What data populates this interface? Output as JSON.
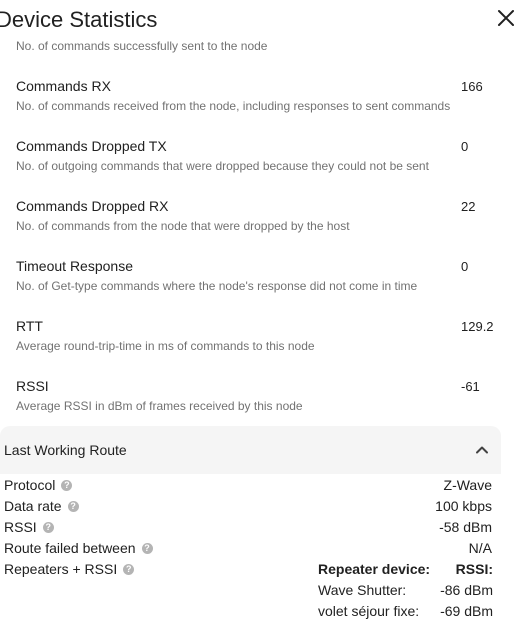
{
  "dialog": {
    "title": "Device Statistics",
    "close_icon": "close-icon"
  },
  "partial_description": "No. of commands successfully sent to the node",
  "stats": [
    {
      "label": "Commands RX",
      "description": "No. of commands received from the node, including responses to sent commands",
      "value": "166"
    },
    {
      "label": "Commands Dropped TX",
      "description": "No. of outgoing commands that were dropped because they could not be sent",
      "value": "0"
    },
    {
      "label": "Commands Dropped RX",
      "description": "No. of commands from the node that were dropped by the host",
      "value": "22"
    },
    {
      "label": "Timeout Response",
      "description": "No. of Get-type commands where the node's response did not come in time",
      "value": "0"
    },
    {
      "label": "RTT",
      "description": "Average round-trip-time in ms of commands to this node",
      "value": "129.2"
    },
    {
      "label": "RSSI",
      "description": "Average RSSI in dBm of frames received by this node",
      "value": "-61"
    }
  ],
  "last_working_route": {
    "title": "Last Working Route",
    "expanded": true,
    "chevron_icon": "chevron-up-icon",
    "help_icon": "help-circle-icon",
    "rows": [
      {
        "label": "Protocol",
        "value": "Z-Wave"
      },
      {
        "label": "Data rate",
        "value": "100 kbps"
      },
      {
        "label": "RSSI",
        "value": "-58 dBm"
      },
      {
        "label": "Route failed between",
        "value": "N/A"
      },
      {
        "label": "Repeaters + RSSI",
        "value": ""
      }
    ],
    "repeaters_header": {
      "device": "Repeater device:",
      "rssi": "RSSI:"
    },
    "repeaters": [
      {
        "name": "Wave Shutter:",
        "rssi": "-86 dBm"
      },
      {
        "name": "volet séjour fixe:",
        "rssi": "-69 dBm"
      }
    ]
  }
}
